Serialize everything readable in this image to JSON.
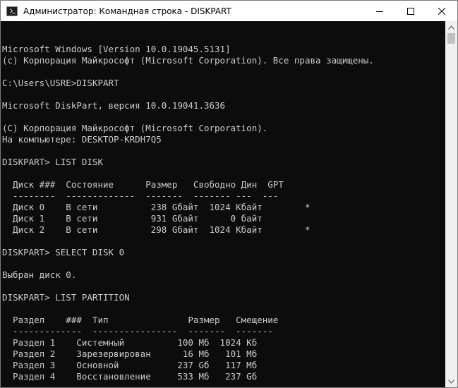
{
  "window": {
    "title": "Администратор: Командная строка - DISKPART",
    "icon": "command-prompt-icon"
  },
  "controls": {
    "minimize_icon": "minimize-icon",
    "maximize_icon": "maximize-icon",
    "close_icon": "close-icon"
  },
  "colors": {
    "console_bg": "#0c0c0c",
    "console_fg": "#cccccc",
    "titlebar_bg": "#ffffff",
    "scrollbar_bg": "#f0f0f0"
  },
  "console": {
    "lines": [
      "Microsoft Windows [Version 10.0.19045.5131]",
      "(c) Корпорация Майкрософт (Microsoft Corporation). Все права защищены.",
      "",
      "C:\\Users\\USRE>DISKPART",
      "",
      "Microsoft DiskPart, версия 10.0.19041.3636",
      "",
      "(C) Корпорация Майкрософт (Microsoft Corporation).",
      "На компьютере: DESKTOP-KRDH7Q5",
      "",
      "DISKPART> LIST DISK",
      "",
      "  Диск ###  Состояние      Размер   Свободно Дин  GPT",
      "  --------  -------------  -------  ------- ---  ---",
      "  Диск 0    В сети          238 Gбайт  1024 Кбайт        *",
      "  Диск 1    В сети          931 Gбайт      0 байт",
      "  Диск 2    В сети          298 Gбайт  1024 Кбайт        *",
      "",
      "DISKPART> SELECT DISK 0",
      "",
      "Выбран диск 0.",
      "",
      "DISKPART> LIST PARTITION",
      "",
      "  Раздел    ###  Тип               Размер   Смещение",
      "  -------------  ----------------  -------  -------",
      "  Раздел 1    Системный          100 Мб  1024 Кб",
      "  Раздел 2    Зарезервирован      16 Мб   101 Мб",
      "  Раздел 3    Основной           237 Gб   117 Мб",
      "  Раздел 4    Восстановление     533 Мб   237 Gб",
      ""
    ],
    "prompt": "DISKPART> "
  }
}
